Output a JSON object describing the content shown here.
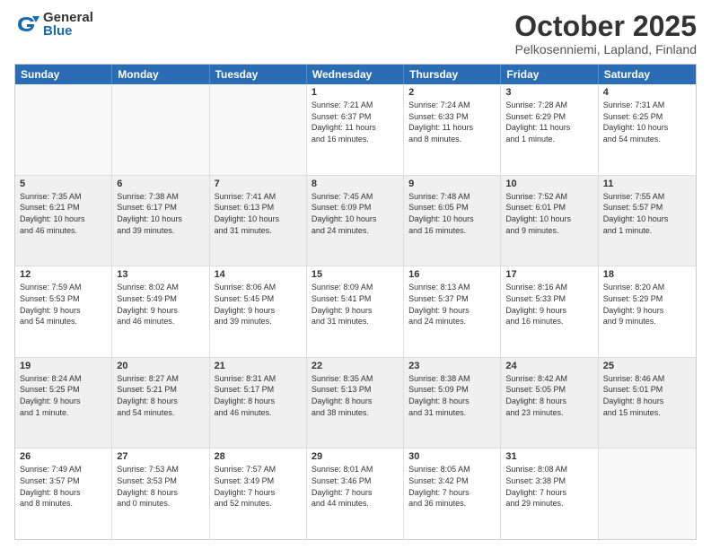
{
  "logo": {
    "general": "General",
    "blue": "Blue"
  },
  "title": {
    "month": "October 2025",
    "location": "Pelkosenniemi, Lapland, Finland"
  },
  "weekdays": [
    "Sunday",
    "Monday",
    "Tuesday",
    "Wednesday",
    "Thursday",
    "Friday",
    "Saturday"
  ],
  "rows": [
    [
      {
        "day": "",
        "info": "",
        "empty": true
      },
      {
        "day": "",
        "info": "",
        "empty": true
      },
      {
        "day": "",
        "info": "",
        "empty": true
      },
      {
        "day": "1",
        "info": "Sunrise: 7:21 AM\nSunset: 6:37 PM\nDaylight: 11 hours\nand 16 minutes."
      },
      {
        "day": "2",
        "info": "Sunrise: 7:24 AM\nSunset: 6:33 PM\nDaylight: 11 hours\nand 8 minutes."
      },
      {
        "day": "3",
        "info": "Sunrise: 7:28 AM\nSunset: 6:29 PM\nDaylight: 11 hours\nand 1 minute."
      },
      {
        "day": "4",
        "info": "Sunrise: 7:31 AM\nSunset: 6:25 PM\nDaylight: 10 hours\nand 54 minutes."
      }
    ],
    [
      {
        "day": "5",
        "info": "Sunrise: 7:35 AM\nSunset: 6:21 PM\nDaylight: 10 hours\nand 46 minutes.",
        "shaded": true
      },
      {
        "day": "6",
        "info": "Sunrise: 7:38 AM\nSunset: 6:17 PM\nDaylight: 10 hours\nand 39 minutes.",
        "shaded": true
      },
      {
        "day": "7",
        "info": "Sunrise: 7:41 AM\nSunset: 6:13 PM\nDaylight: 10 hours\nand 31 minutes.",
        "shaded": true
      },
      {
        "day": "8",
        "info": "Sunrise: 7:45 AM\nSunset: 6:09 PM\nDaylight: 10 hours\nand 24 minutes.",
        "shaded": true
      },
      {
        "day": "9",
        "info": "Sunrise: 7:48 AM\nSunset: 6:05 PM\nDaylight: 10 hours\nand 16 minutes.",
        "shaded": true
      },
      {
        "day": "10",
        "info": "Sunrise: 7:52 AM\nSunset: 6:01 PM\nDaylight: 10 hours\nand 9 minutes.",
        "shaded": true
      },
      {
        "day": "11",
        "info": "Sunrise: 7:55 AM\nSunset: 5:57 PM\nDaylight: 10 hours\nand 1 minute.",
        "shaded": true
      }
    ],
    [
      {
        "day": "12",
        "info": "Sunrise: 7:59 AM\nSunset: 5:53 PM\nDaylight: 9 hours\nand 54 minutes."
      },
      {
        "day": "13",
        "info": "Sunrise: 8:02 AM\nSunset: 5:49 PM\nDaylight: 9 hours\nand 46 minutes."
      },
      {
        "day": "14",
        "info": "Sunrise: 8:06 AM\nSunset: 5:45 PM\nDaylight: 9 hours\nand 39 minutes."
      },
      {
        "day": "15",
        "info": "Sunrise: 8:09 AM\nSunset: 5:41 PM\nDaylight: 9 hours\nand 31 minutes."
      },
      {
        "day": "16",
        "info": "Sunrise: 8:13 AM\nSunset: 5:37 PM\nDaylight: 9 hours\nand 24 minutes."
      },
      {
        "day": "17",
        "info": "Sunrise: 8:16 AM\nSunset: 5:33 PM\nDaylight: 9 hours\nand 16 minutes."
      },
      {
        "day": "18",
        "info": "Sunrise: 8:20 AM\nSunset: 5:29 PM\nDaylight: 9 hours\nand 9 minutes."
      }
    ],
    [
      {
        "day": "19",
        "info": "Sunrise: 8:24 AM\nSunset: 5:25 PM\nDaylight: 9 hours\nand 1 minute.",
        "shaded": true
      },
      {
        "day": "20",
        "info": "Sunrise: 8:27 AM\nSunset: 5:21 PM\nDaylight: 8 hours\nand 54 minutes.",
        "shaded": true
      },
      {
        "day": "21",
        "info": "Sunrise: 8:31 AM\nSunset: 5:17 PM\nDaylight: 8 hours\nand 46 minutes.",
        "shaded": true
      },
      {
        "day": "22",
        "info": "Sunrise: 8:35 AM\nSunset: 5:13 PM\nDaylight: 8 hours\nand 38 minutes.",
        "shaded": true
      },
      {
        "day": "23",
        "info": "Sunrise: 8:38 AM\nSunset: 5:09 PM\nDaylight: 8 hours\nand 31 minutes.",
        "shaded": true
      },
      {
        "day": "24",
        "info": "Sunrise: 8:42 AM\nSunset: 5:05 PM\nDaylight: 8 hours\nand 23 minutes.",
        "shaded": true
      },
      {
        "day": "25",
        "info": "Sunrise: 8:46 AM\nSunset: 5:01 PM\nDaylight: 8 hours\nand 15 minutes.",
        "shaded": true
      }
    ],
    [
      {
        "day": "26",
        "info": "Sunrise: 7:49 AM\nSunset: 3:57 PM\nDaylight: 8 hours\nand 8 minutes."
      },
      {
        "day": "27",
        "info": "Sunrise: 7:53 AM\nSunset: 3:53 PM\nDaylight: 8 hours\nand 0 minutes."
      },
      {
        "day": "28",
        "info": "Sunrise: 7:57 AM\nSunset: 3:49 PM\nDaylight: 7 hours\nand 52 minutes."
      },
      {
        "day": "29",
        "info": "Sunrise: 8:01 AM\nSunset: 3:46 PM\nDaylight: 7 hours\nand 44 minutes."
      },
      {
        "day": "30",
        "info": "Sunrise: 8:05 AM\nSunset: 3:42 PM\nDaylight: 7 hours\nand 36 minutes."
      },
      {
        "day": "31",
        "info": "Sunrise: 8:08 AM\nSunset: 3:38 PM\nDaylight: 7 hours\nand 29 minutes."
      },
      {
        "day": "",
        "info": "",
        "empty": true
      }
    ]
  ]
}
